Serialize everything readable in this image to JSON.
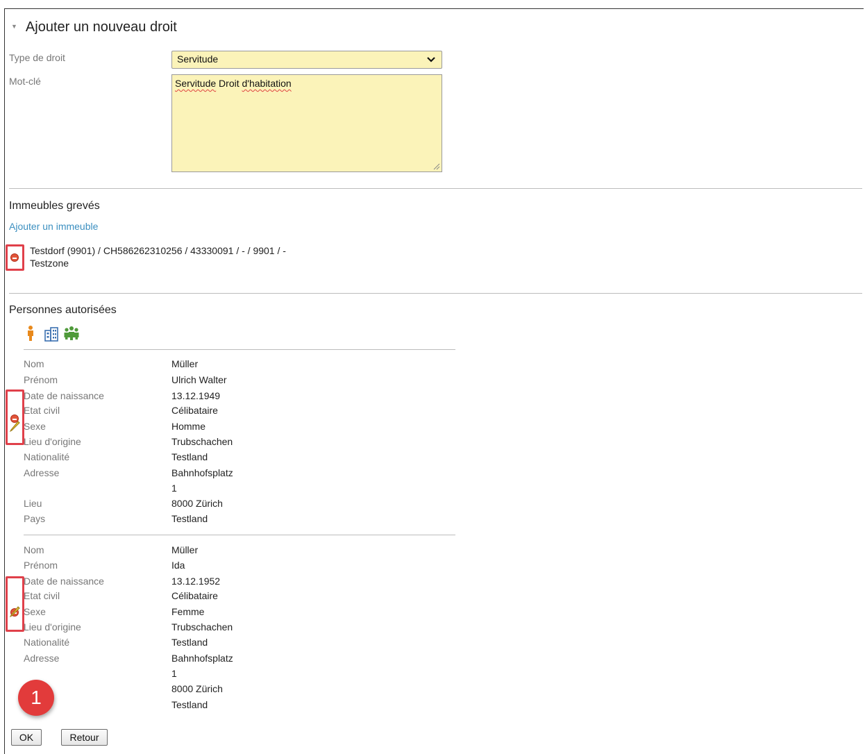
{
  "form": {
    "section_title": "Ajouter un nouveau droit",
    "type_label": "Type de droit",
    "type_value": "Servitude",
    "keyword_label": "Mot-clé",
    "keyword_value_word1": "Servitude",
    "keyword_value_word2": "Droit",
    "keyword_value_word3": "d'habitation"
  },
  "properties": {
    "title": "Immeubles grevés",
    "add_link": "Ajouter un immeuble",
    "item_line1": "Testdorf (9901) / CH586262310256 / 43330091 / - / 9901 / -",
    "item_line2": "Testzone"
  },
  "persons": {
    "title": "Personnes autorisées",
    "labels": {
      "nom": "Nom",
      "prenom": "Prénom",
      "naissance": "Date de naissance",
      "etat_civil": "Etat civil",
      "sexe": "Sexe",
      "origine": "Lieu d'origine",
      "nationalite": "Nationalité",
      "adresse": "Adresse",
      "lieu": "Lieu",
      "pays": "Pays"
    },
    "p1": {
      "nom": "Müller",
      "prenom": "Ulrich Walter",
      "naissance": "13.12.1949",
      "etat_civil": "Célibataire",
      "sexe": "Homme",
      "origine": "Trubschachen",
      "nationalite": "Testland",
      "adresse1": "Bahnhofsplatz",
      "adresse2": "1",
      "lieu": "8000 Zürich",
      "pays": "Testland"
    },
    "p2": {
      "nom": "Müller",
      "prenom": "Ida",
      "naissance": "13.12.1952",
      "etat_civil": "Célibataire",
      "sexe": "Femme",
      "origine": "Trubschachen",
      "nationalite": "Testland",
      "adresse1": "Bahnhofsplatz",
      "adresse2": "1",
      "lieu": "8000 Zürich",
      "pays": "Testland"
    }
  },
  "buttons": {
    "ok": "OK",
    "back": "Retour"
  },
  "callout": {
    "number": "1"
  },
  "icons": {
    "collapse": "collapse-triangle-icon",
    "remove": "remove-icon",
    "edit": "pencil-icon",
    "add_person": "person-icon",
    "add_company": "building-icon",
    "add_group": "group-icon"
  },
  "colors": {
    "field_bg": "#fbf3b9",
    "link": "#3b8fc0",
    "highlight_box": "#e0404a",
    "remove_icon": "#e2553a",
    "callout": "#e23b3b"
  }
}
